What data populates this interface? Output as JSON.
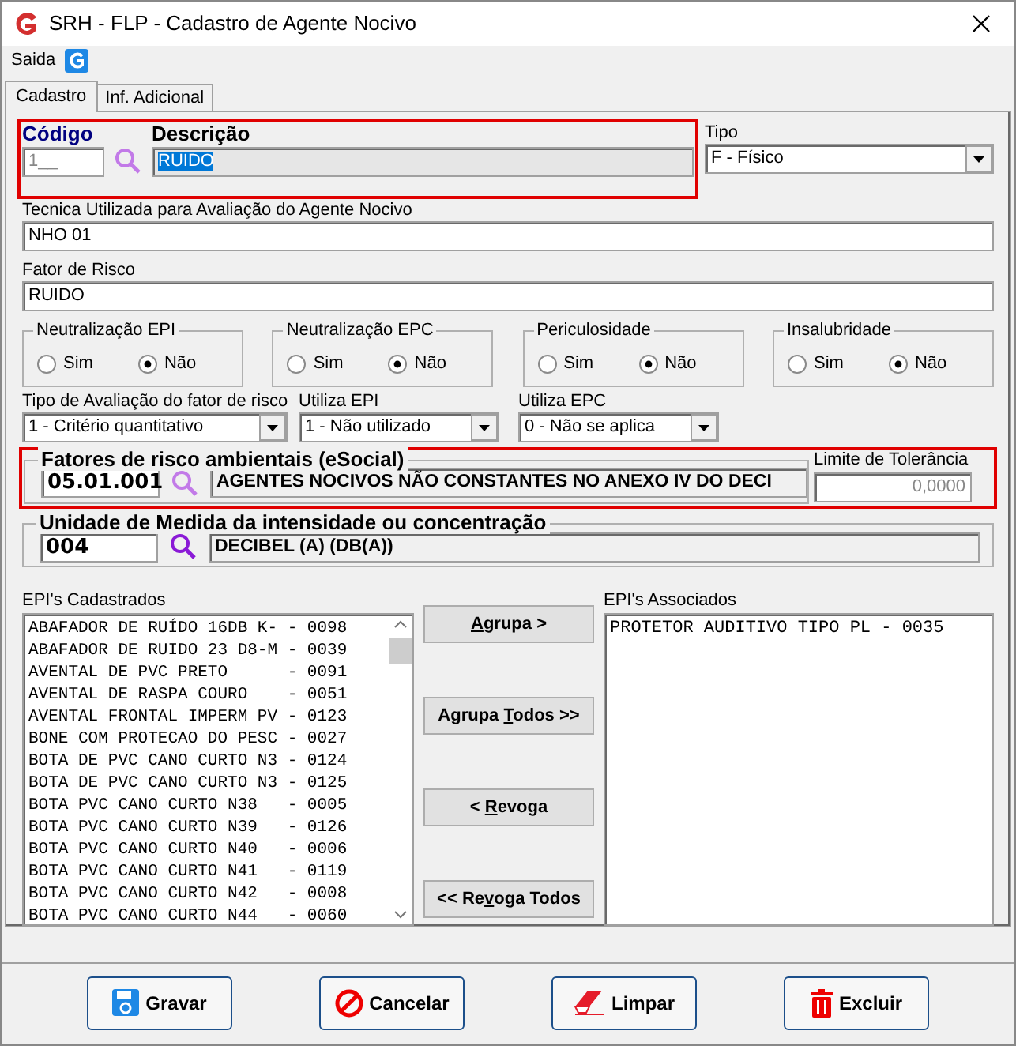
{
  "window": {
    "title": "SRH - FLP - Cadastro de Agente Nocivo"
  },
  "menu": [
    {
      "label": "Saida"
    }
  ],
  "tabs": [
    {
      "label": "Cadastro",
      "selected": true
    },
    {
      "label": "Inf. Adicional",
      "selected": false
    }
  ],
  "codigo": {
    "label": "Código",
    "value": "1__",
    "disabled": true
  },
  "descricao": {
    "label": "Descrição",
    "value": "RUIDO",
    "selected": true
  },
  "tipo": {
    "label": "Tipo",
    "value": "F - Físico"
  },
  "tecnica": {
    "label": "Tecnica Utilizada para Avaliação do Agente Nocivo",
    "value": "NHO 01"
  },
  "fator": {
    "label": "Fator de Risco",
    "value": "RUIDO"
  },
  "radio_groups": [
    {
      "label": "Neutralização EPI",
      "options": [
        {
          "label": "Sim",
          "selected": false
        },
        {
          "label": "Não",
          "selected": true
        }
      ]
    },
    {
      "label": "Neutralização EPC",
      "options": [
        {
          "label": "Sim",
          "selected": false
        },
        {
          "label": "Não",
          "selected": true
        }
      ]
    },
    {
      "label": "Periculosidade",
      "options": [
        {
          "label": "Sim",
          "selected": false
        },
        {
          "label": "Não",
          "selected": true
        }
      ]
    },
    {
      "label": "Insalubridade",
      "options": [
        {
          "label": "Sim",
          "selected": false
        },
        {
          "label": "Não",
          "selected": true
        }
      ]
    }
  ],
  "combos": [
    {
      "label": "Tipo de Avaliação do fator de risco",
      "value": "1 - Critério quantitativo"
    },
    {
      "label": "Utiliza EPI",
      "value": "1 - Não utilizado"
    },
    {
      "label": "Utiliza EPC",
      "value": "0 - Não se aplica"
    }
  ],
  "fatores": {
    "label": "Fatores de risco ambientais (eSocial)",
    "code": "05.01.001",
    "description": "AGENTES NOCIVOS NÃO CONSTANTES NO ANEXO IV DO DECI"
  },
  "limite": {
    "label": "Limite de Tolerância",
    "value": "0,0000",
    "disabled": true
  },
  "unidade": {
    "label": "Unidade de Medida da intensidade ou concentração",
    "code": "004",
    "description": "DECIBEL (A) (DB(A))"
  },
  "epi_cadastrados": {
    "label": "EPI's Cadastrados",
    "items": [
      "ABAFADOR DE RUÍDO 16DB K- - 0098",
      "ABAFADOR DE RUIDO 23 D8-M - 0039",
      "AVENTAL DE PVC PRETO      - 0091",
      "AVENTAL DE RASPA COURO    - 0051",
      "AVENTAL FRONTAL IMPERM PV - 0123",
      "BONE COM PROTECAO DO PESC - 0027",
      "BOTA DE PVC CANO CURTO N3 - 0124",
      "BOTA DE PVC CANO CURTO N3 - 0125",
      "BOTA PVC CANO CURTO N38   - 0005",
      "BOTA PVC CANO CURTO N39   - 0126",
      "BOTA PVC CANO CURTO N40   - 0006",
      "BOTA PVC CANO CURTO N41   - 0119",
      "BOTA PVC CANO CURTO N42   - 0008",
      "BOTA PVC CANO CURTO N44   - 0060"
    ]
  },
  "transfer_buttons": [
    {
      "accel": "A",
      "after": "grupa >"
    },
    {
      "before": "Agrupa ",
      "accel": "T",
      "after": "odos >>"
    },
    {
      "before": "< ",
      "accel": "R",
      "after": "evoga"
    },
    {
      "before": "<< Re",
      "accel": "v",
      "after": "oga Todos"
    }
  ],
  "epi_associados": {
    "label": "EPI's Associados",
    "items": [
      "PROTETOR AUDITIVO TIPO PL - 0035"
    ]
  },
  "actions": [
    {
      "label": "Gravar",
      "kind": "save"
    },
    {
      "label": "Cancelar",
      "kind": "cancel"
    },
    {
      "label": "Limpar",
      "kind": "clear"
    },
    {
      "label": "Excluir",
      "kind": "delete"
    }
  ]
}
